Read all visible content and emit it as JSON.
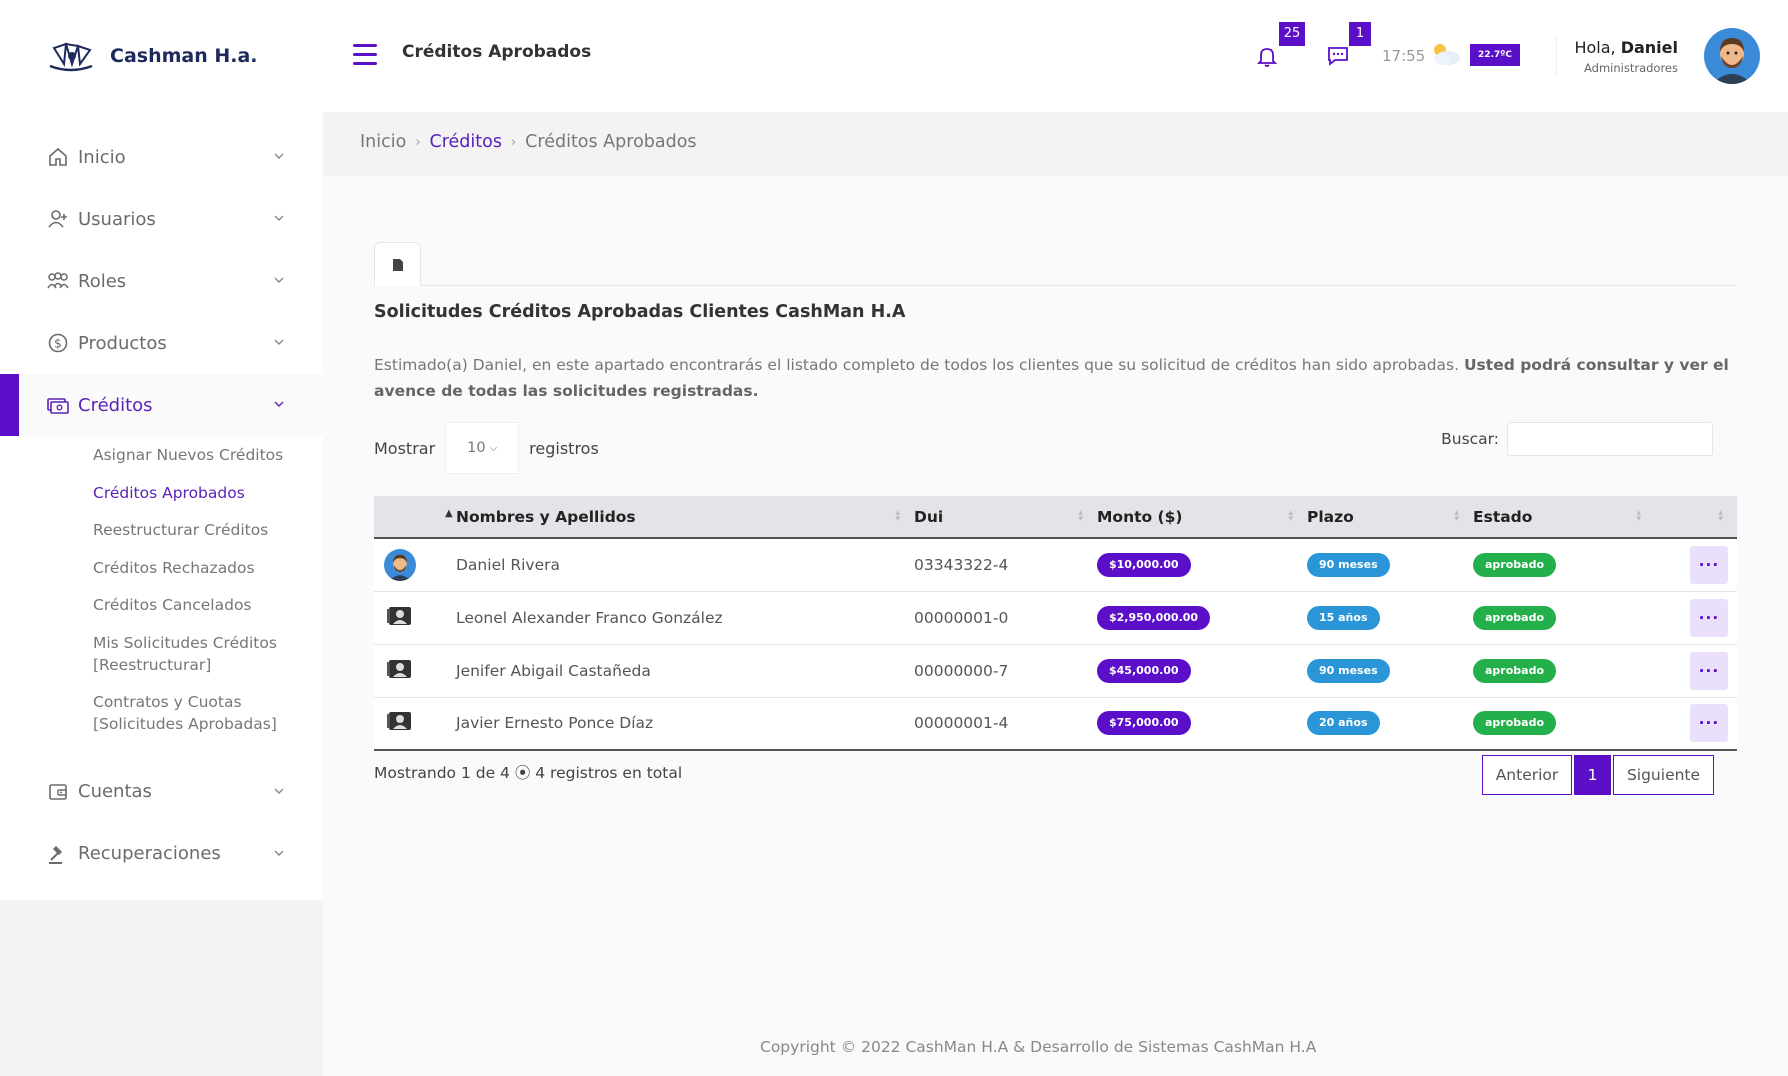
{
  "brand": {
    "name": "Cashman H.a."
  },
  "sidebar": {
    "items": [
      {
        "label": "Inicio",
        "icon": "home-icon"
      },
      {
        "label": "Usuarios",
        "icon": "user-plus-icon"
      },
      {
        "label": "Roles",
        "icon": "users-group-icon"
      },
      {
        "label": "Productos",
        "icon": "dollar-circle-icon"
      },
      {
        "label": "Créditos",
        "icon": "money-icon",
        "active": true
      },
      {
        "label": "Cuentas",
        "icon": "wallet-icon"
      },
      {
        "label": "Recuperaciones",
        "icon": "gavel-icon"
      }
    ],
    "subitems": [
      "Asignar Nuevos Créditos",
      "Créditos Aprobados",
      "Reestructurar Créditos",
      "Créditos Rechazados",
      "Créditos Cancelados",
      "Mis Solicitudes Créditos [Reestructurar]",
      "Contratos y Cuotas [Solicitudes Aprobadas]"
    ]
  },
  "header": {
    "title": "Créditos Aprobados",
    "notifications_count": "25",
    "messages_count": "1",
    "time": "17:55",
    "temperature": "22.7ºC",
    "greeting": "Hola,",
    "user_name": "Daniel",
    "user_role": "Administradores",
    "accent_color": "#5b0fc9"
  },
  "breadcrumb": {
    "home": "Inicio",
    "parent": "Créditos",
    "current": "Créditos Aprobados"
  },
  "main": {
    "section_title": "Solicitudes Créditos Aprobadas Clientes CashMan H.A",
    "desc_text": "Estimado(a) Daniel, en este apartado encontrarás el listado completo de todos los clientes que su solicitud de créditos han sido aprobadas. ",
    "desc_bold": "Usted podrá consultar y ver el avence de todas las solicitudes registradas.",
    "show_label": "Mostrar",
    "page_size": "10",
    "records_label": "registros",
    "search_label": "Buscar:",
    "search_value": ""
  },
  "table": {
    "columns": [
      "",
      "Nombres y Apellidos",
      "Dui",
      "Monto ($)",
      "Plazo",
      "Estado",
      ""
    ],
    "rows": [
      {
        "name": "Daniel Rivera",
        "dui": "03343322-4",
        "monto": "$10,000.00",
        "plazo": "90 meses",
        "estado": "aprobado",
        "photo": "avatar"
      },
      {
        "name": "Leonel Alexander Franco González",
        "dui": "00000001-0",
        "monto": "$2,950,000.00",
        "plazo": "15 años",
        "estado": "aprobado",
        "photo": "placeholder"
      },
      {
        "name": "Jenifer Abigail Castañeda",
        "dui": "00000000-7",
        "monto": "$45,000.00",
        "plazo": "90 meses",
        "estado": "aprobado",
        "photo": "placeholder"
      },
      {
        "name": "Javier Ernesto Ponce Díaz",
        "dui": "00000001-4",
        "monto": "$75,000.00",
        "plazo": "20 años",
        "estado": "aprobado",
        "photo": "placeholder"
      }
    ],
    "more_label": "···"
  },
  "pagination": {
    "info": "Mostrando 1 de 4 ⦿ 4 registros en total",
    "prev": "Anterior",
    "current": "1",
    "next": "Siguiente"
  },
  "footer": {
    "text": "Copyright © 2022 CashMan H.A & Desarrollo de Sistemas CashMan H.A"
  }
}
